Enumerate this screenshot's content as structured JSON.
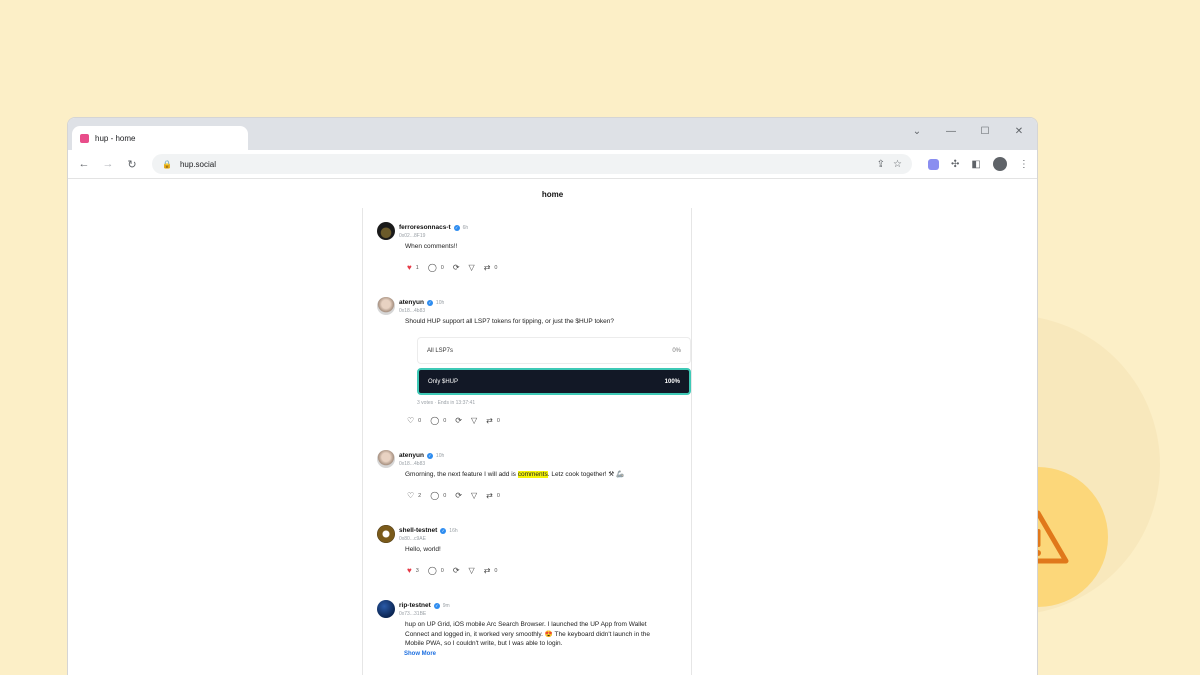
{
  "browser": {
    "tab_title": "hup - home",
    "url": "hup.social"
  },
  "page": {
    "title": "home"
  },
  "posts": [
    {
      "name": "ferroresonnacs-t",
      "time": "6h",
      "address": "0x02...8F19",
      "text": "When comments!!",
      "likes": "1",
      "comments": "0",
      "tips": "0",
      "liked": true
    },
    {
      "name": "atenyun",
      "time": "10h",
      "address": "0x18...4b83",
      "text": "Should HUP support all LSP7 tokens for tipping, or just the $HUP token?",
      "poll": {
        "options": [
          {
            "label": "All LSP7s",
            "percent": "0%"
          },
          {
            "label": "Only $HUP",
            "percent": "100%"
          }
        ],
        "meta": "3 votes · Ends in 13:37:41"
      },
      "likes": "0",
      "comments": "0",
      "tips": "0",
      "liked": false
    },
    {
      "name": "atenyun",
      "time": "10h",
      "address": "0x18...4b83",
      "text_before": "Gmorning, the next feature I will add is ",
      "text_highlight": "comments",
      "text_after": ". Letz cook together! ⚒ 🦾",
      "likes": "2",
      "comments": "0",
      "tips": "0",
      "liked": false
    },
    {
      "name": "shell-testnet",
      "time": "16h",
      "address": "0x80...c9AE",
      "text": "Hello, world!",
      "likes": "3",
      "comments": "0",
      "tips": "0",
      "liked": true
    },
    {
      "name": "rip-testnet",
      "time": "9m",
      "address": "0x73...31BE",
      "text": "hup on UP Grid, iOS mobile Arc Search Browser. I launched the UP App from Wallet Connect and logged in, it worked very smoothly. 😍 The keyboard didn't launch in the Mobile PWA, so I couldn't write, but I was able to login.",
      "show_more": "Show More"
    }
  ],
  "icons": {
    "warning": "warning-triangle-icon",
    "like": "heart-icon",
    "comment": "comment-icon",
    "repost": "repost-icon",
    "share": "send-icon",
    "tip": "tip-icon"
  },
  "colors": {
    "background": "#fcefc7",
    "warning_circle": "#fcd77a",
    "warning_icon": "#e0781b",
    "poll_selected_bg": "#121826",
    "poll_selected_border": "#3ec9b6",
    "highlight": "#f5f50a",
    "link": "#1d6fe0",
    "verified": "#2d8cf0"
  }
}
